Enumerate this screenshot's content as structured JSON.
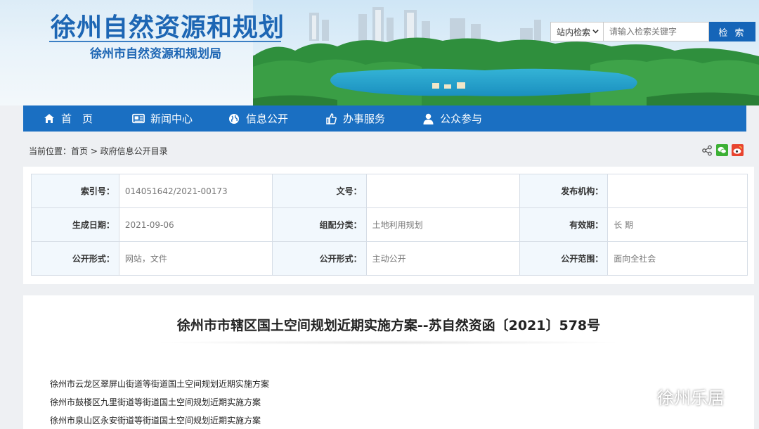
{
  "header": {
    "site_title": "徐州自然资源和规划",
    "site_subtitle": "徐州市自然资源和规划局",
    "search": {
      "scope": "站内检索",
      "placeholder": "请输入检索关键字",
      "button": "检 索"
    }
  },
  "nav": {
    "items": [
      {
        "label": "首　页",
        "icon": "home-icon"
      },
      {
        "label": "新闻中心",
        "icon": "news-icon"
      },
      {
        "label": "信息公开",
        "icon": "globe-icon"
      },
      {
        "label": "办事服务",
        "icon": "thumbs-up-icon"
      },
      {
        "label": "公众参与",
        "icon": "user-icon"
      }
    ]
  },
  "breadcrumb": "当前位置：首页 > 政府信息公开目录",
  "info": {
    "rows": [
      [
        {
          "label": "索引号：",
          "value": "014051642/2021-00173"
        },
        {
          "label": "文号：",
          "value": ""
        },
        {
          "label": "发布机构：",
          "value": ""
        }
      ],
      [
        {
          "label": "生成日期：",
          "value": "2021-09-06"
        },
        {
          "label": "组配分类：",
          "value": "土地利用规划"
        },
        {
          "label": "有效期：",
          "value": "长 期"
        }
      ],
      [
        {
          "label": "公开形式：",
          "value": "网站，文件"
        },
        {
          "label": "公开形式：",
          "value": "主动公开"
        },
        {
          "label": "公开范围：",
          "value": "面向全社会"
        }
      ]
    ]
  },
  "document": {
    "title": "徐州市市辖区国土空间规划近期实施方案--苏自然资函〔2021〕578号",
    "links": [
      "徐州市云龙区翠屏山街道等街道国土空间规划近期实施方案",
      "徐州市鼓楼区九里街道等街道国土空间规划近期实施方案",
      "徐州市泉山区永安街道等街道国土空间规划近期实施方案"
    ]
  },
  "watermark": "徐州乐居",
  "colors": {
    "nav_bg": "#1a6fc2",
    "title_blue": "#1d66b4",
    "search_button": "#1565b8"
  }
}
